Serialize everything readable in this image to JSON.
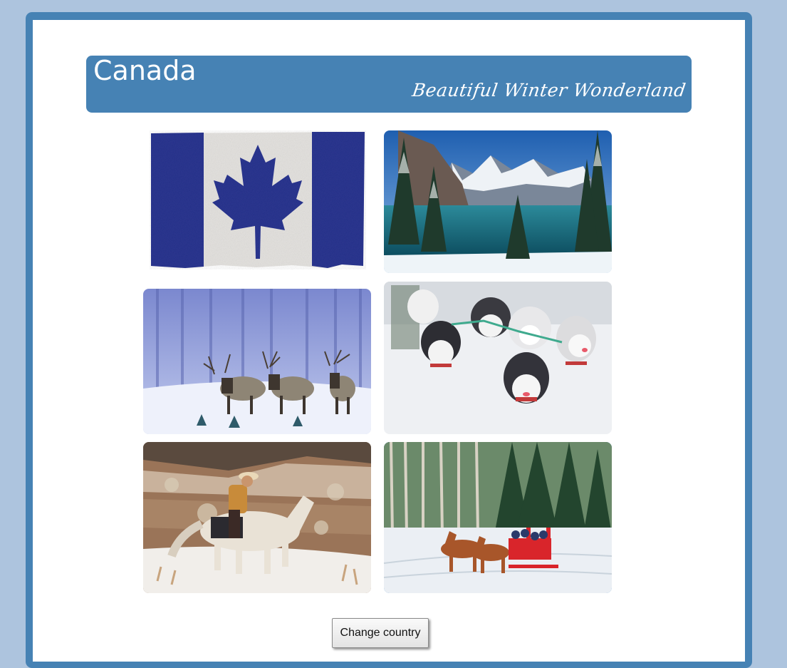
{
  "header": {
    "title": "Canada",
    "subtitle": "Beautiful Winter Wonderland"
  },
  "gallery": {
    "images": [
      {
        "id": "flag",
        "icon": "canadian-flag-image"
      },
      {
        "id": "lake",
        "icon": "mountain-lake-image"
      },
      {
        "id": "elk",
        "icon": "elk-in-snow-image"
      },
      {
        "id": "huskies",
        "icon": "husky-sled-dogs-image"
      },
      {
        "id": "rider",
        "icon": "cowboy-horse-snow-image"
      },
      {
        "id": "sleigh",
        "icon": "horse-drawn-sleigh-image"
      }
    ]
  },
  "actions": {
    "change_country_label": "Change country"
  },
  "colors": {
    "background": "#adc4de",
    "frame": "#4682b4",
    "banner": "#4682b4",
    "panel": "#ffffff"
  }
}
